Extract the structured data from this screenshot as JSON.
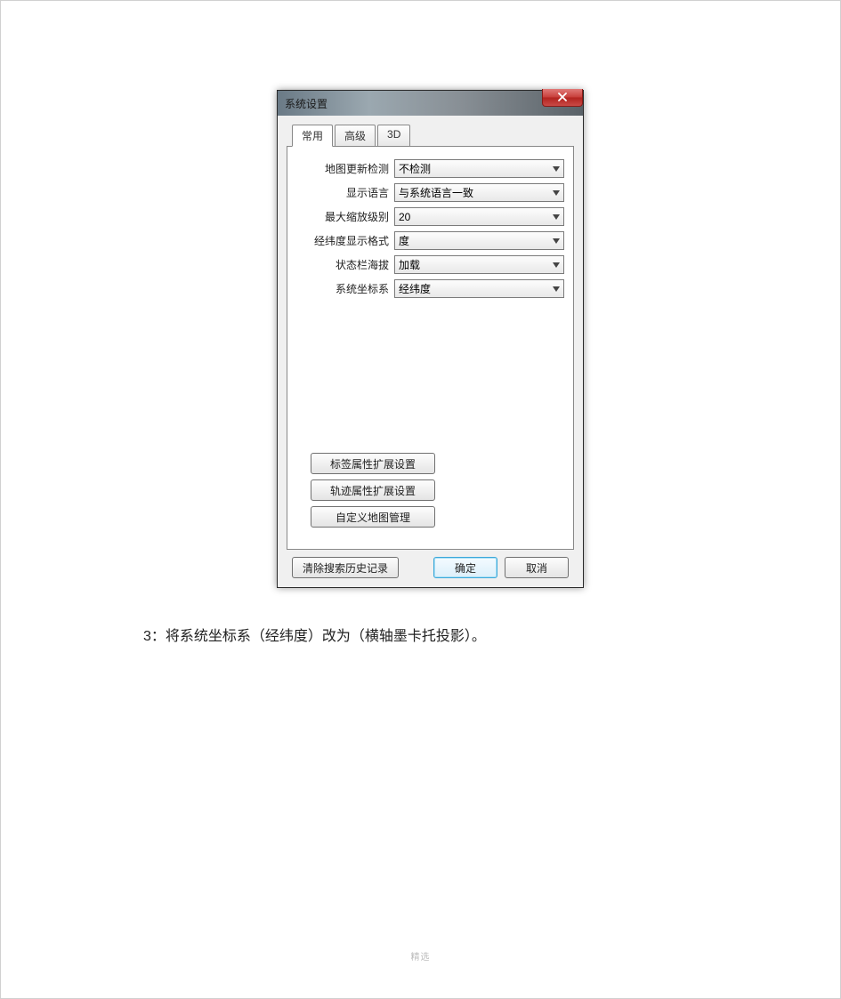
{
  "dialog": {
    "title": "系统设置",
    "close_icon": "close-icon",
    "tabs": [
      {
        "label": "常用",
        "active": true
      },
      {
        "label": "高级",
        "active": false
      },
      {
        "label": "3D",
        "active": false
      }
    ],
    "fields": [
      {
        "label": "地图更新检测",
        "value": "不检测"
      },
      {
        "label": "显示语言",
        "value": "与系统语言一致"
      },
      {
        "label": "最大缩放级别",
        "value": "20"
      },
      {
        "label": "经纬度显示格式",
        "value": "度"
      },
      {
        "label": "状态栏海拔",
        "value": "加载"
      },
      {
        "label": "系统坐标系",
        "value": "经纬度"
      }
    ],
    "ext_buttons": [
      "标签属性扩展设置",
      "轨迹属性扩展设置",
      "自定义地图管理"
    ],
    "bottom": {
      "clear": "清除搜索历史记录",
      "ok": "确定",
      "cancel": "取消"
    }
  },
  "instruction": "3：将系统坐标系（经纬度）改为（横轴墨卡托投影）。",
  "footer": "精选"
}
